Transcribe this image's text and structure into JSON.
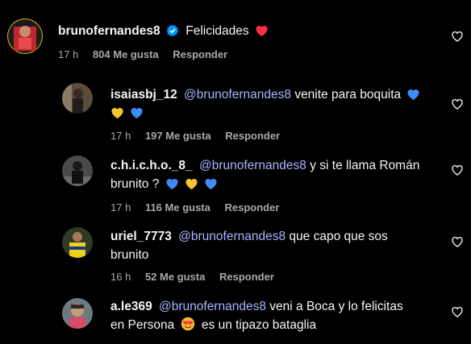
{
  "comments": [
    {
      "username": "brunofernandes8",
      "verified": true,
      "text": "Felicidades",
      "time": "17 h",
      "likes": "804 Me gusta",
      "reply": "Responder"
    },
    {
      "username": "isaiasbj_12",
      "mention": "@brunofernandes8",
      "text_line1": "venite para boquita",
      "time": "17 h",
      "likes": "197 Me gusta",
      "reply": "Responder"
    },
    {
      "username": "c.h.i.c.h.o._8_",
      "mention": "@brunofernandes8",
      "text_line1": "y si te llama Román",
      "text_line2": "brunito ?",
      "time": "17 h",
      "likes": "116 Me gusta",
      "reply": "Responder"
    },
    {
      "username": "uriel_7773",
      "mention": "@brunofernandes8",
      "text_line1": "que capo que sos",
      "text_line2": "brunito",
      "time": "16 h",
      "likes": "52 Me gusta",
      "reply": "Responder"
    },
    {
      "username": "a.le369",
      "mention": "@brunofernandes8",
      "text_line1": "veni a Boca y lo felicitas",
      "text_line2_a": "en Persona",
      "text_line2_b": "es un tipazo bataglia"
    }
  ],
  "colors": {
    "background": "#000000",
    "mention": "#a8b4ff",
    "meta": "#a8a8a8",
    "verified": "#0095f6",
    "red_heart": "#ff3040",
    "blue_heart": "#3e8bf5",
    "yellow_heart": "#f7c62f"
  },
  "icons": [
    "verified-badge-icon",
    "like-heart-icon",
    "red-heart-emoji",
    "blue-heart-emoji",
    "yellow-heart-emoji",
    "heart-eyes-emoji"
  ]
}
